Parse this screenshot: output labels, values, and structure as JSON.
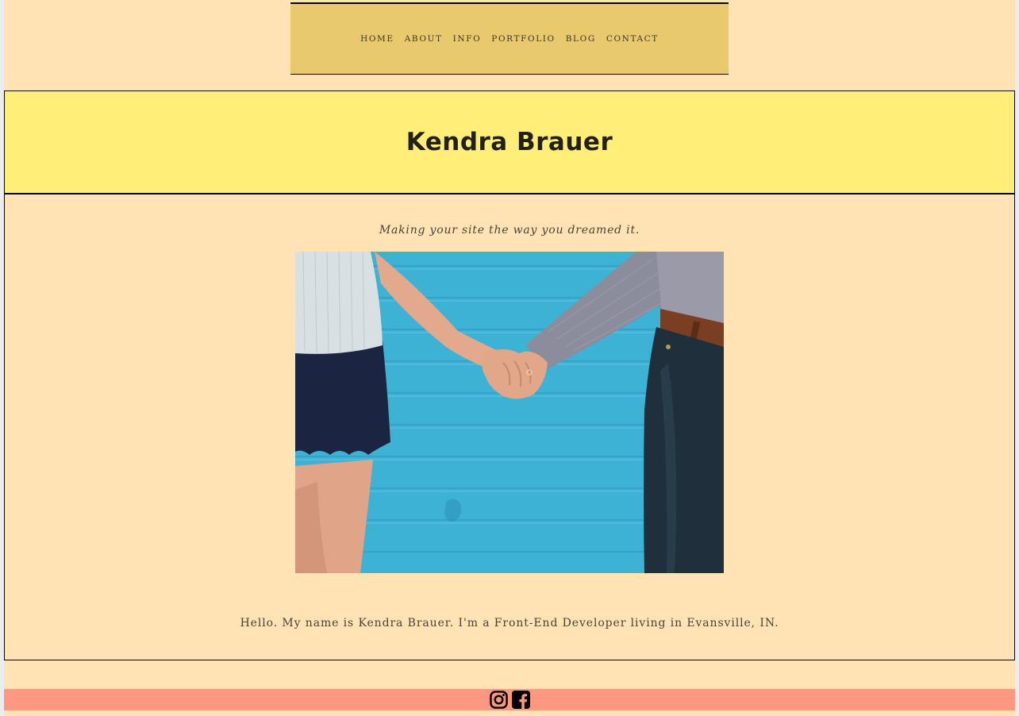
{
  "nav": {
    "items": [
      {
        "label": "HOME"
      },
      {
        "label": "ABOUT"
      },
      {
        "label": "INFO"
      },
      {
        "label": "PORTFOLIO"
      },
      {
        "label": "BLOG"
      },
      {
        "label": "CONTACT"
      }
    ]
  },
  "hero": {
    "title": "Kendra Brauer"
  },
  "main": {
    "tagline": "Making your site the way you dreamed it.",
    "photo": {
      "alt": "Couple holding hands in front of a blue wall"
    },
    "intro": "Hello. My name is Kendra Brauer. I'm a Front-End Developer living in Evansville, IN."
  },
  "footer": {
    "social": [
      {
        "icon": "instagram-icon"
      },
      {
        "icon": "facebook-icon"
      }
    ]
  },
  "colors": {
    "page_bg": "#ffe3b5",
    "nav_bg": "#e9c96d",
    "hero_bg": "#ffee78",
    "footer_bg": "#fe9880",
    "outer_bg": "#ecebf0"
  }
}
